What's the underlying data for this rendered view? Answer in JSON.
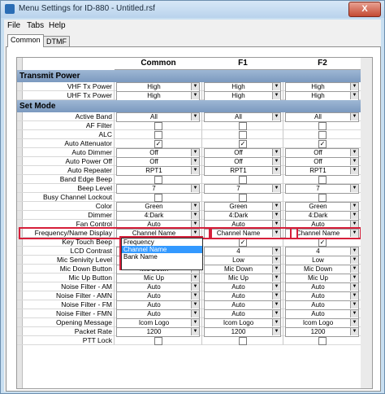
{
  "window": {
    "title": "Menu Settings for ID-880 - Untitled.rsf",
    "close_label": "X"
  },
  "menu": [
    {
      "label": "File"
    },
    {
      "label": "Tabs"
    },
    {
      "label": "Help"
    }
  ],
  "tabs": [
    {
      "label": "Common"
    },
    {
      "label": "DTMF"
    }
  ],
  "columns": [
    "Common",
    "F1",
    "F2"
  ],
  "sections": [
    {
      "title": "Transmit Power",
      "rows": [
        {
          "label": "VHF Tx Power",
          "type": "dd",
          "values": [
            "High",
            "High",
            "High"
          ]
        },
        {
          "label": "UHF Tx Power",
          "type": "dd",
          "values": [
            "High",
            "High",
            "High"
          ]
        }
      ]
    },
    {
      "title": "Set Mode",
      "rows": [
        {
          "label": "Active Band",
          "type": "dd",
          "values": [
            "All",
            "All",
            "All"
          ]
        },
        {
          "label": "AF Filter",
          "type": "cb",
          "values": [
            "",
            "",
            ""
          ]
        },
        {
          "label": "ALC",
          "type": "cb",
          "values": [
            "",
            "",
            ""
          ]
        },
        {
          "label": "Auto Attenuator",
          "type": "cb",
          "values": [
            "✓",
            "✓",
            "✓"
          ]
        },
        {
          "label": "Auto Dimmer",
          "type": "dd",
          "values": [
            "Off",
            "Off",
            "Off"
          ]
        },
        {
          "label": "Auto Power Off",
          "type": "dd",
          "values": [
            "Off",
            "Off",
            "Off"
          ]
        },
        {
          "label": "Auto Repeater",
          "type": "dd",
          "values": [
            "RPT1",
            "RPT1",
            "RPT1"
          ]
        },
        {
          "label": "Band Edge Beep",
          "type": "cb",
          "values": [
            "",
            "",
            ""
          ]
        },
        {
          "label": "Beep Level",
          "type": "dd",
          "values": [
            "7",
            "7",
            "7"
          ]
        },
        {
          "label": "Busy Channel Lockout",
          "type": "cb",
          "values": [
            "",
            "",
            ""
          ]
        },
        {
          "label": "Color",
          "type": "dd",
          "values": [
            "Green",
            "Green",
            "Green"
          ]
        },
        {
          "label": "Dimmer",
          "type": "dd",
          "values": [
            "4:Dark",
            "4:Dark",
            "4:Dark"
          ]
        },
        {
          "label": "Fan Control",
          "type": "dd",
          "values": [
            "Auto",
            "Auto",
            "Auto"
          ]
        },
        {
          "label": "Frequency/Name Display",
          "type": "dd",
          "values": [
            "Channel Name",
            "Channel Name",
            "Channel Name"
          ]
        },
        {
          "label": "Key Touch Beep",
          "type": "cb",
          "values": [
            "",
            "✓",
            "✓"
          ]
        },
        {
          "label": "LCD Contrast",
          "type": "dd",
          "values": [
            "",
            "4",
            "4"
          ]
        },
        {
          "label": "Mic Senivity Level",
          "type": "dd",
          "values": [
            "",
            "Low",
            "Low"
          ]
        },
        {
          "label": "Mic Down Button",
          "type": "dd",
          "values": [
            "Mic Down",
            "Mic Down",
            "Mic Down"
          ]
        },
        {
          "label": "Mic Up Button",
          "type": "dd",
          "values": [
            "Mic Up",
            "Mic Up",
            "Mic Up"
          ]
        },
        {
          "label": "Noise Filter - AM",
          "type": "dd",
          "values": [
            "Auto",
            "Auto",
            "Auto"
          ]
        },
        {
          "label": "Noise Filter - AMN",
          "type": "dd",
          "values": [
            "Auto",
            "Auto",
            "Auto"
          ]
        },
        {
          "label": "Noise Filter - FM",
          "type": "dd",
          "values": [
            "Auto",
            "Auto",
            "Auto"
          ]
        },
        {
          "label": "Noise Filter - FMN",
          "type": "dd",
          "values": [
            "Auto",
            "Auto",
            "Auto"
          ]
        },
        {
          "label": "Opening Message",
          "type": "dd",
          "values": [
            "Icom Logo",
            "Icom Logo",
            "Icom Logo"
          ]
        },
        {
          "label": "Packet Rate",
          "type": "dd",
          "values": [
            "1200",
            "1200",
            "1200"
          ]
        },
        {
          "label": "PTT Lock",
          "type": "cb",
          "values": [
            "",
            "",
            ""
          ]
        }
      ]
    }
  ],
  "dropdown_options": [
    {
      "label": "Frequency",
      "selected": false
    },
    {
      "label": "Channel Name",
      "selected": true
    },
    {
      "label": "Bank Name",
      "selected": false
    }
  ],
  "highlight_color": "#d61f3a"
}
